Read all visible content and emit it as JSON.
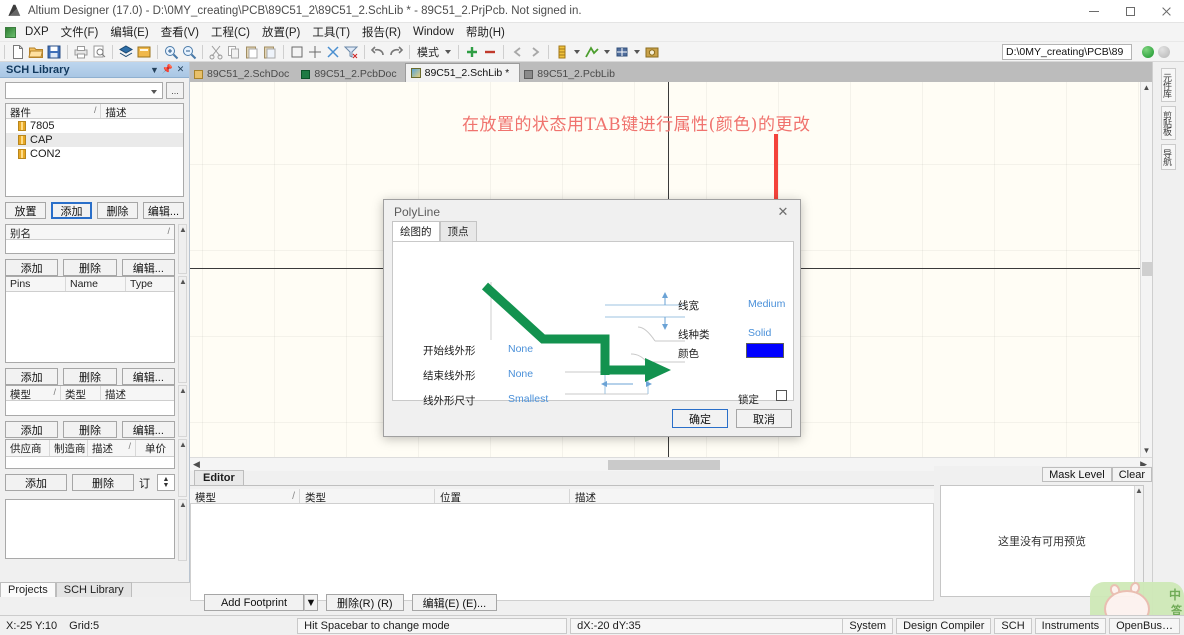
{
  "window": {
    "title": "Altium Designer (17.0) - D:\\0MY_creating\\PCB\\89C51_2\\89C51_2.SchLib * - 89C51_2.PrjPcb. Not signed in.",
    "app_icon": "altium-a-icon",
    "minimize": "–",
    "maximize": "□",
    "close": "×"
  },
  "menubar": {
    "items": [
      {
        "label": "DXP",
        "key": "X"
      },
      {
        "label": "文件(F)"
      },
      {
        "label": "编辑(E)"
      },
      {
        "label": "查看(V)"
      },
      {
        "label": "工程(C)"
      },
      {
        "label": "放置(P)"
      },
      {
        "label": "工具(T)"
      },
      {
        "label": "报告(R)"
      },
      {
        "label": "Window"
      },
      {
        "label": "帮助(H)"
      }
    ]
  },
  "toolbar": {
    "mode_label": "模式",
    "address_value": "D:\\0MY_creating\\PCB\\89",
    "icons": [
      "new-document-icon",
      "open-folder-icon",
      "save-icon",
      "print-icon",
      "print-preview-icon",
      "layers-icon",
      "document-board-icon",
      "zoom-in-icon",
      "zoom-out-icon",
      "cut-icon",
      "copy-icon",
      "paste-icon",
      "paste-special-icon",
      "select-area-icon",
      "move-icon",
      "deselect-icon",
      "clear-filter-icon",
      "undo-icon",
      "redo-icon",
      "add-green-icon",
      "remove-red-icon",
      "back-arrow-icon",
      "forward-arrow-icon",
      "component-icon",
      "footprint-icon",
      "grid-icon",
      "snapshot-icon"
    ]
  },
  "document_tabs": [
    {
      "label": "89C51_2.SchDoc",
      "icon": "schdoc-icon",
      "active": false
    },
    {
      "label": "89C51_2.PcbDoc",
      "icon": "pcbdoc-icon",
      "active": false
    },
    {
      "label": "89C51_2.SchLib *",
      "icon": "schlib-icon",
      "active": true
    },
    {
      "label": "89C51_2.PcbLib",
      "icon": "pcblib-icon",
      "active": false
    }
  ],
  "sidebar": {
    "title": "SCH Library",
    "header_buttons": [
      "dropdown-icon",
      "pin-icon",
      "close-icon"
    ],
    "search": {
      "value": "",
      "placeholder": ""
    },
    "browse_button": "...",
    "components": {
      "headers": [
        "器件",
        "描述"
      ],
      "sort_mark": "/",
      "rows": [
        {
          "name": "7805",
          "desc": "",
          "selected": false
        },
        {
          "name": "CAP",
          "desc": "",
          "selected": true
        },
        {
          "name": "CON2",
          "desc": "",
          "selected": false
        }
      ],
      "buttons": [
        "放置",
        "添加",
        "删除",
        "编辑..."
      ],
      "focused_button": "添加"
    },
    "aliases": {
      "header": "别名",
      "sort_mark": "/",
      "buttons": [
        "添加",
        "删除",
        "编辑..."
      ]
    },
    "pins": {
      "headers": [
        "Pins",
        "Name",
        "Type"
      ],
      "buttons": [
        "添加",
        "删除",
        "编辑..."
      ]
    },
    "models": {
      "headers": [
        "模型",
        "类型",
        "描述"
      ],
      "sort_mark": "/",
      "buttons": [
        "添加",
        "删除",
        "编辑..."
      ]
    },
    "suppliers": {
      "headers": [
        "供应商",
        "制造商",
        "描述",
        "单价"
      ],
      "sort_mark": "/",
      "buttons": [
        "添加",
        "删除"
      ],
      "order_label": "订",
      "order_value": ""
    },
    "bottom_tabs": [
      {
        "label": "Projects",
        "active": true
      },
      {
        "label": "SCH Library",
        "active": false
      }
    ]
  },
  "canvas": {
    "annotation": "在放置的状态用TAB键进行属性(颜色)的更改",
    "annotation_color": "#f0736e",
    "arrow_color": "#f4433b",
    "background": "#fffdf5"
  },
  "right_tabs": [
    {
      "label": "元件库"
    },
    {
      "label": "剪贴板"
    },
    {
      "label": "导航"
    }
  ],
  "dialog": {
    "title": "PolyLine",
    "close": "✕",
    "tabs": [
      {
        "label": "绘图的",
        "active": true
      },
      {
        "label": "顶点",
        "active": false
      }
    ],
    "fields": [
      {
        "name": "line-width",
        "label": "线宽",
        "value": "Medium"
      },
      {
        "name": "line-style",
        "label": "线种类",
        "value": "Solid"
      },
      {
        "name": "color",
        "label": "颜色",
        "value": "#0000FF",
        "type": "swatch"
      },
      {
        "name": "start-line-shape",
        "label": "开始线外形",
        "value": "None"
      },
      {
        "name": "end-line-shape",
        "label": "结束线外形",
        "value": "None"
      },
      {
        "name": "line-shape-size",
        "label": "线外形尺寸",
        "value": "Smallest"
      },
      {
        "name": "locked",
        "label": "锁定",
        "value": false,
        "type": "checkbox"
      }
    ],
    "preview_color": "#13924f",
    "buttons": {
      "ok": "确定",
      "cancel": "取消"
    }
  },
  "editor_panel": {
    "tab": "Editor",
    "headers": [
      "模型",
      "类型",
      "位置",
      "描述"
    ],
    "sort_mark": "/",
    "rows": [],
    "buttons": [
      {
        "label": "Add Footprint",
        "underline": "A",
        "split": true
      },
      {
        "label": "删除(R) (R)"
      },
      {
        "label": "编辑(E) (E)..."
      }
    ]
  },
  "preview_panel": {
    "buttons": [
      "Mask Level",
      "Clear"
    ],
    "empty_text": "这里没有可用预览"
  },
  "statusbar": {
    "coords": "X:-25 Y:10",
    "grid": "Grid:5",
    "hint": "Hit Spacebar to change mode",
    "delta": "dX:-20 dY:35",
    "panels": [
      "System",
      "Design Compiler",
      "SCH",
      "Instruments",
      "OpenBus…"
    ]
  },
  "watermark": {
    "text1": "中",
    "text2": "答"
  }
}
